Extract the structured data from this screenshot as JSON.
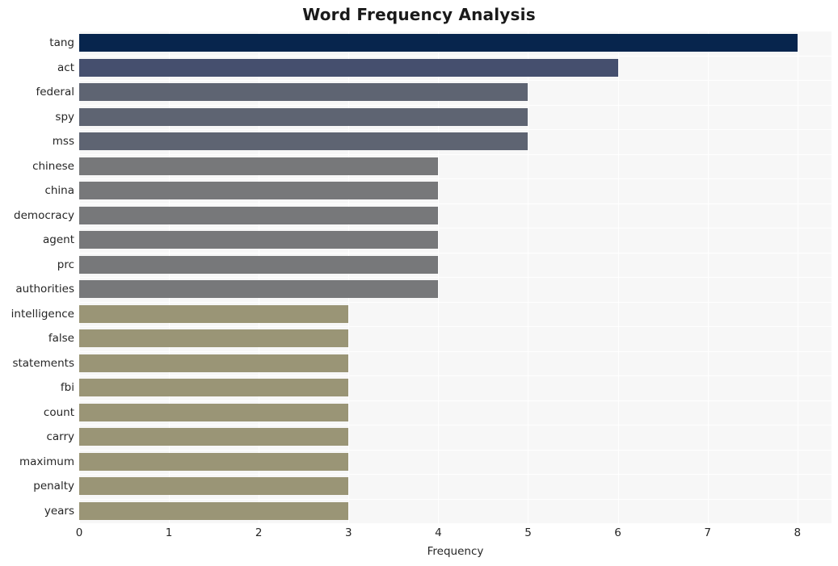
{
  "chart_data": {
    "type": "bar",
    "orientation": "horizontal",
    "title": "Word Frequency Analysis",
    "xlabel": "Frequency",
    "ylabel": "",
    "xlim": [
      0,
      8.38
    ],
    "xticks": [
      0,
      1,
      2,
      3,
      4,
      5,
      6,
      7,
      8
    ],
    "xtick_labels": [
      "0",
      "1",
      "2",
      "3",
      "4",
      "5",
      "6",
      "7",
      "8"
    ],
    "grid": true,
    "legend": null,
    "categories": [
      "tang",
      "act",
      "federal",
      "spy",
      "mss",
      "chinese",
      "china",
      "democracy",
      "agent",
      "prc",
      "authorities",
      "intelligence",
      "false",
      "statements",
      "fbi",
      "count",
      "carry",
      "maximum",
      "penalty",
      "years"
    ],
    "values": [
      8,
      6,
      5,
      5,
      5,
      4,
      4,
      4,
      4,
      4,
      4,
      3,
      3,
      3,
      3,
      3,
      3,
      3,
      3,
      3
    ],
    "bar_colors": [
      "#07254d",
      "#454f6e",
      "#5e6472",
      "#5e6472",
      "#5e6472",
      "#77787a",
      "#77787a",
      "#77787a",
      "#77787a",
      "#77787a",
      "#77787a",
      "#9a9576",
      "#9a9576",
      "#9a9576",
      "#9a9576",
      "#9a9576",
      "#9a9576",
      "#9a9576",
      "#9a9576",
      "#9a9576"
    ],
    "plot_background": "#f7f7f7",
    "gridline_color": "#ffffff",
    "figure_background": "#ffffff"
  }
}
